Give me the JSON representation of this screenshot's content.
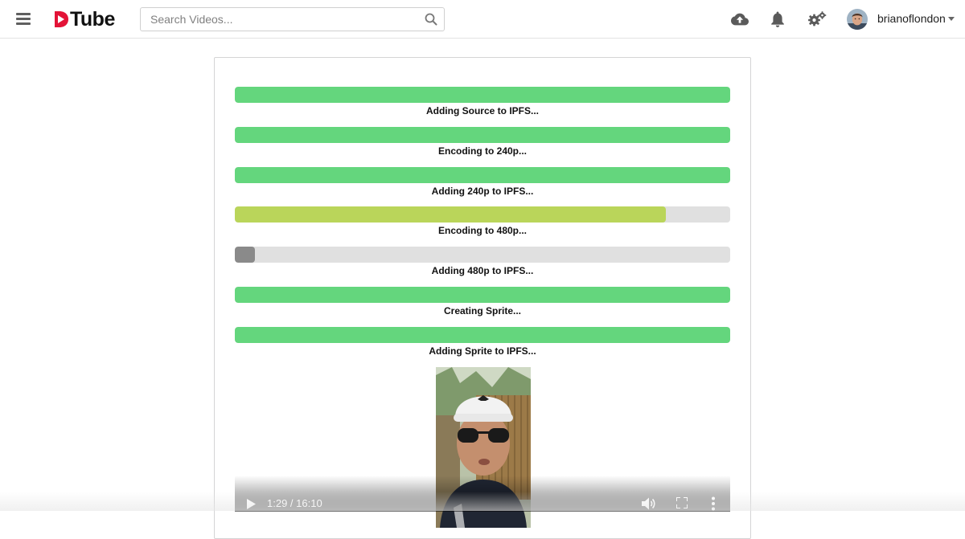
{
  "header": {
    "logo_text": "Tube",
    "search": {
      "placeholder": "Search Videos...",
      "value": ""
    },
    "icons": [
      "menu-icon",
      "search-icon",
      "cloud-upload-icon",
      "bell-icon",
      "gears-icon"
    ],
    "user": {
      "name": "brianoflondon"
    }
  },
  "colors": {
    "brand_red": "#e31337",
    "complete_green": "#64d67d",
    "in_progress_green": "#bad55a",
    "pending_gray": "#8a8a8a",
    "track_gray": "#e0e0e0"
  },
  "upload_steps": [
    {
      "label": "Adding Source to IPFS...",
      "progress": 1.0,
      "state": "complete"
    },
    {
      "label": "Encoding to 240p...",
      "progress": 1.0,
      "state": "complete"
    },
    {
      "label": "Adding 240p to IPFS...",
      "progress": 1.0,
      "state": "complete"
    },
    {
      "label": "Encoding to 480p...",
      "progress": 0.87,
      "state": "in-progress"
    },
    {
      "label": "Adding 480p to IPFS...",
      "progress": 0.04,
      "state": "pending"
    },
    {
      "label": "Creating Sprite...",
      "progress": 1.0,
      "state": "complete"
    },
    {
      "label": "Adding Sprite to IPFS...",
      "progress": 1.0,
      "state": "complete"
    }
  ],
  "player": {
    "time": "1:29 / 16:10",
    "icons": [
      "play-icon",
      "volume-icon",
      "fullscreen-icon",
      "more-vertical-icon"
    ]
  }
}
